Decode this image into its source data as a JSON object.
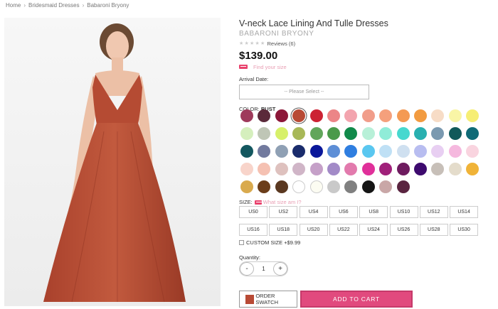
{
  "breadcrumb": [
    "Home",
    "Bridesmaid Dresses",
    "Babaroni Bryony"
  ],
  "product": {
    "title": "V-neck Lace Lining And Tulle Dresses",
    "brand": "BABARONI BRYONY",
    "reviews": "Reviews (6)",
    "price": "$139.00",
    "find_size": "Find your size",
    "rating_stars": 5
  },
  "arrival": {
    "label": "Arrival Date:",
    "placeholder": "-- Please Select --"
  },
  "color": {
    "label": "COLOR:",
    "selected": "RUST"
  },
  "swatches": [
    [
      "#9e3a5b",
      "#5b2a3a",
      "#8c1738",
      "#b84a35",
      "#cc2233",
      "#ec8587",
      "#f3a4ae",
      "#f19d8a",
      "#f5a07c",
      "#f49a54",
      "#f29b40",
      "#f7dcc6",
      "#f9f5a6",
      "#f6ee74"
    ],
    [
      "#d5efbd",
      "#bfc6b6",
      "#d7f06a",
      "#a8b858",
      "#61a65b",
      "#4a9a4a",
      "#118a4a",
      "#b8f0d8",
      "#90ecd8",
      "#47d8cf",
      "#29b0b0",
      "#7a99b0",
      "#11595a",
      "#0f6b77"
    ],
    [
      "#13575f",
      "#727a9e",
      "#8fa0b4",
      "#1a2c6c",
      "#0a179a",
      "#5d8ed6",
      "#2f7ee0",
      "#5ac7f0",
      "#bfe0f5",
      "#cfe0f0",
      "#b8bdf0",
      "#e8cff2",
      "#f5b8de",
      "#f9d4df"
    ],
    [
      "#f8d4ca",
      "#f5c1b2",
      "#dec1be",
      "#d0b5c7",
      "#c5a0c8",
      "#a28ac7",
      "#e27aad",
      "#e0309a",
      "#a0207a",
      "#6e1b5f",
      "#3d0a6e",
      "#c7bfb8",
      "#e4dccb",
      "#f0b338"
    ],
    [
      "#d9aa4e",
      "#6b3d1a",
      "#5a3820",
      "#ffffff",
      "#fcfcf2",
      "#c9c9c9",
      "#808080",
      "#151515",
      "#c9a7a7",
      "#5a2440"
    ]
  ],
  "size": {
    "label": "SIZE:",
    "what_size": "What size am I?",
    "options": [
      "US0",
      "US2",
      "US4",
      "US6",
      "US8",
      "US10",
      "US12",
      "US14",
      "US16",
      "US18",
      "US20",
      "US22",
      "US24",
      "US26",
      "US28",
      "US30"
    ]
  },
  "custom_size": "CUSTOM SIZE +$9.99",
  "quantity": {
    "label": "Quantity:",
    "value": "1",
    "minus": "-",
    "plus": "+"
  },
  "buttons": {
    "order_swatch": "ORDER SWATCH",
    "add_to_cart": "ADD TO CART"
  }
}
